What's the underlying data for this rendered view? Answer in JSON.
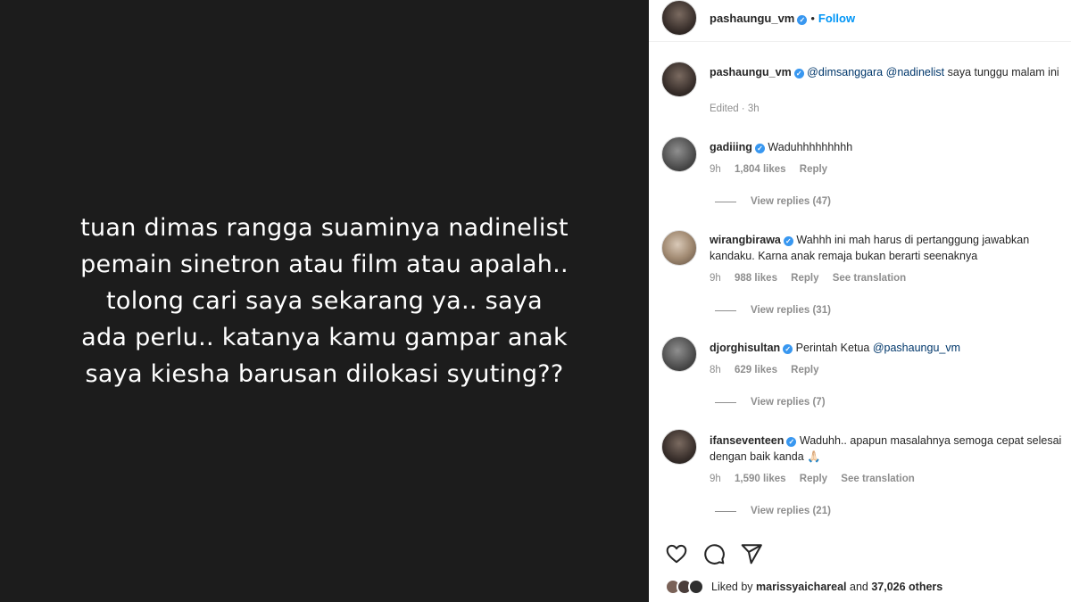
{
  "story": {
    "lines": [
      "tuan dimas rangga suaminya nadinelist",
      "pemain sinetron atau film atau apalah..",
      "tolong cari saya sekarang ya.. saya",
      "ada perlu.. katanya kamu gampar anak",
      "saya kiesha barusan dilokasi syuting??"
    ]
  },
  "header": {
    "username": "pashaungu_vm",
    "separator": "•",
    "follow_label": "Follow"
  },
  "caption": {
    "username": "pashaungu_vm",
    "mention1": "@dimsanggara",
    "mention2": "@nadinelist",
    "text": "saya tunggu malam ini",
    "meta": "Edited · 3h"
  },
  "comments": [
    {
      "username": "gadiiing",
      "text": "Waduhhhhhhhhh",
      "time": "9h",
      "likes": "1,804 likes",
      "reply": "Reply",
      "view_replies": "View replies (47)"
    },
    {
      "username": "wirangbirawa",
      "text": "Wahhh ini mah harus di pertanggung jawabkan kandaku. Karna anak remaja bukan berarti seenaknya",
      "time": "9h",
      "likes": "988 likes",
      "reply": "Reply",
      "translation": "See translation",
      "view_replies": "View replies (31)"
    },
    {
      "username": "djorghisultan",
      "text": "Perintah Ketua",
      "mention": "@pashaungu_vm",
      "time": "8h",
      "likes": "629 likes",
      "reply": "Reply",
      "view_replies": "View replies (7)"
    },
    {
      "username": "ifanseventeen",
      "text": "Waduhh.. apapun masalahnya semoga cepat selesai dengan baik kanda 🙏🏻",
      "time": "9h",
      "likes": "1,590 likes",
      "reply": "Reply",
      "translation": "See translation",
      "view_replies": "View replies (21)"
    }
  ],
  "footer": {
    "liked_by_prefix": "Liked by",
    "liked_by_user": "marissyaichareal",
    "and": "and",
    "others": "37,026 others"
  },
  "icons": [
    "heart-icon",
    "comment-icon",
    "share-icon",
    "verified-icon"
  ],
  "colors": {
    "media_bg": "#1c1c1c",
    "link": "#0095f6",
    "verified": "#3897f0",
    "muted": "#8e8e8e",
    "text": "#262626"
  }
}
